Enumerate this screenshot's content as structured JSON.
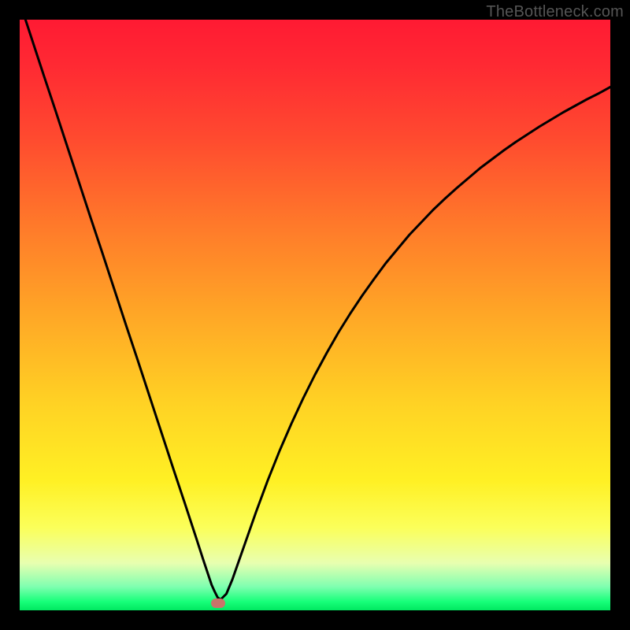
{
  "watermark": "TheBottleneck.com",
  "chart_data": {
    "type": "line",
    "title": "",
    "xlabel": "",
    "ylabel": "",
    "xlim": [
      0,
      1
    ],
    "ylim": [
      0,
      1
    ],
    "x": [
      0.0,
      0.02,
      0.04,
      0.06,
      0.08,
      0.1,
      0.12,
      0.14,
      0.16,
      0.18,
      0.2,
      0.22,
      0.24,
      0.26,
      0.28,
      0.3,
      0.31,
      0.315,
      0.32,
      0.325,
      0.33,
      0.335,
      0.34,
      0.35,
      0.36,
      0.38,
      0.4,
      0.42,
      0.44,
      0.46,
      0.48,
      0.5,
      0.52,
      0.54,
      0.56,
      0.58,
      0.6,
      0.62,
      0.64,
      0.66,
      0.68,
      0.7,
      0.72,
      0.74,
      0.76,
      0.78,
      0.8,
      0.82,
      0.84,
      0.86,
      0.88,
      0.9,
      0.92,
      0.94,
      0.96,
      0.98,
      1.0
    ],
    "values": [
      1.03,
      0.969,
      0.908,
      0.848,
      0.787,
      0.726,
      0.665,
      0.605,
      0.544,
      0.483,
      0.423,
      0.362,
      0.301,
      0.24,
      0.18,
      0.119,
      0.088,
      0.073,
      0.058,
      0.043,
      0.032,
      0.022,
      0.018,
      0.028,
      0.052,
      0.109,
      0.166,
      0.22,
      0.27,
      0.316,
      0.359,
      0.399,
      0.436,
      0.471,
      0.503,
      0.533,
      0.561,
      0.588,
      0.612,
      0.636,
      0.657,
      0.678,
      0.697,
      0.715,
      0.732,
      0.749,
      0.764,
      0.779,
      0.793,
      0.806,
      0.819,
      0.831,
      0.843,
      0.854,
      0.865,
      0.875,
      0.886
    ],
    "marker": {
      "x": 0.336,
      "y": 0.012
    },
    "grid": false,
    "legend": false,
    "background_gradient": {
      "stops": [
        {
          "pos": 0.0,
          "color": "#ff1a33"
        },
        {
          "pos": 0.5,
          "color": "#ffa726"
        },
        {
          "pos": 0.78,
          "color": "#fff024"
        },
        {
          "pos": 0.96,
          "color": "#7fffb0"
        },
        {
          "pos": 1.0,
          "color": "#00e860"
        }
      ]
    }
  },
  "colors": {
    "curve": "#000000",
    "marker": "#c9746a",
    "frame": "#000000"
  }
}
